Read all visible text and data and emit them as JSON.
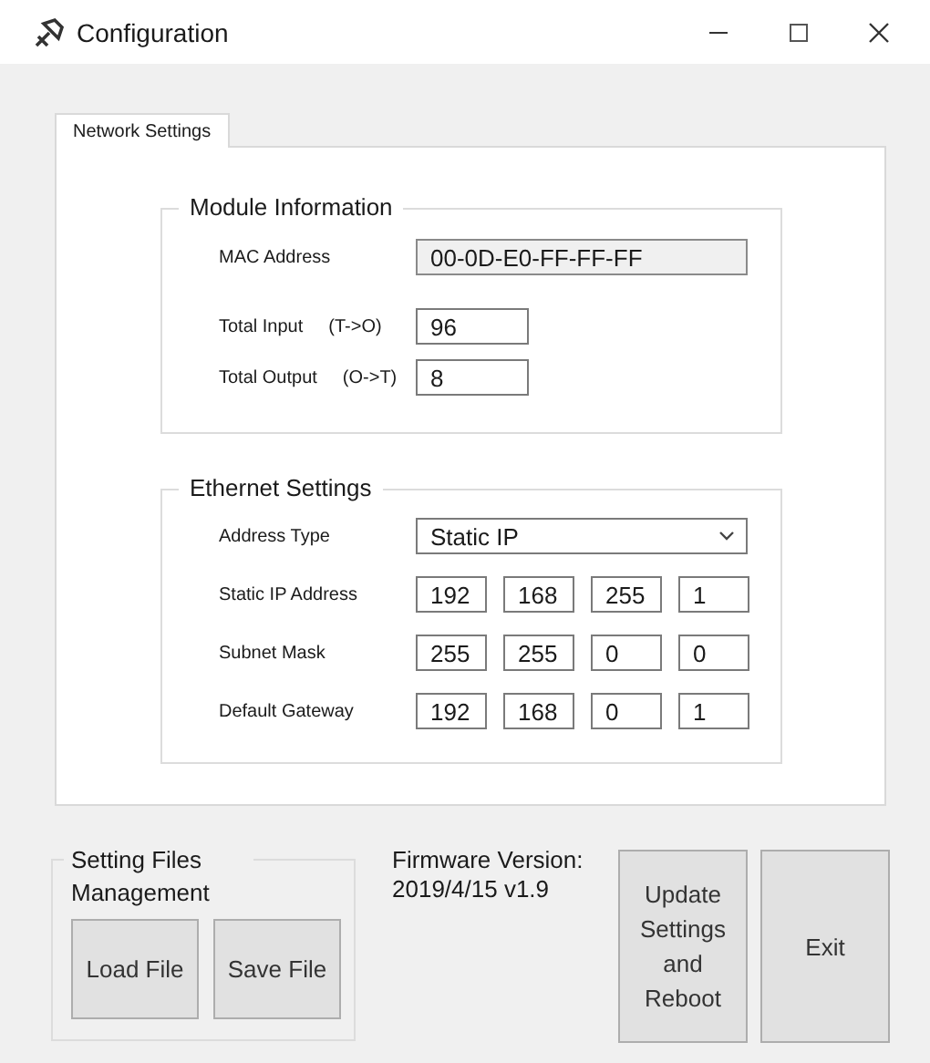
{
  "window": {
    "title": "Configuration"
  },
  "tabs": [
    {
      "label": "Network Settings",
      "selected": true
    }
  ],
  "module_information": {
    "title": "Module Information",
    "fields": [
      {
        "label": "MAC Address",
        "value": "00-0D-E0-FF-FF-FF",
        "disabled": true
      },
      {
        "label": "Total Input",
        "direction": "(T->O)",
        "value": "96",
        "disabled": false
      },
      {
        "label": "Total Output",
        "direction": "(O->T)",
        "value": "8",
        "disabled": false
      }
    ]
  },
  "ethernet_settings": {
    "title": "Ethernet Settings",
    "address_type": {
      "label": "Address Type",
      "value": "Static IP"
    },
    "addresses": [
      {
        "label": "Static IP Address",
        "octets": [
          "192",
          "168",
          "255",
          "1"
        ]
      },
      {
        "label": "Subnet Mask",
        "octets": [
          "255",
          "255",
          "0",
          "0"
        ]
      },
      {
        "label": "Default Gateway",
        "octets": [
          "192",
          "168",
          "0",
          "1"
        ]
      }
    ]
  },
  "setting_files": {
    "title": "Setting Files Management",
    "buttons": [
      "Load File",
      "Save File"
    ]
  },
  "firmware": {
    "label": "Firmware Version:",
    "value": "2019/4/15 v1.9"
  },
  "buttons": [
    "Update Settings and Reboot",
    "Exit"
  ]
}
